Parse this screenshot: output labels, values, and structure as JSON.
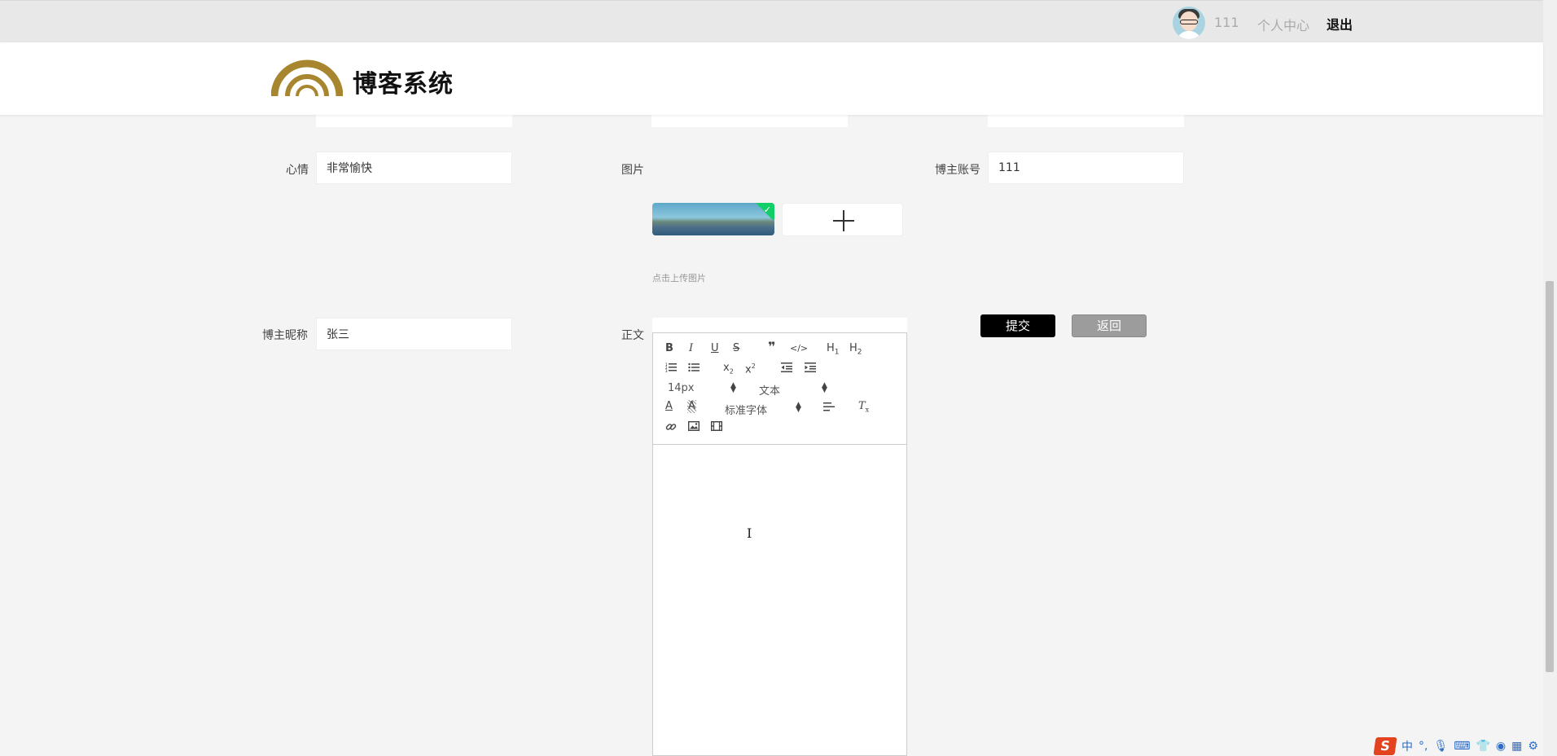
{
  "topbar": {
    "username": "111",
    "personal_center": "个人中心",
    "logout": "退出"
  },
  "header": {
    "site_title": "博客系统"
  },
  "form": {
    "mood_label": "心情",
    "mood_value": "非常愉快",
    "image_label": "图片",
    "upload_tip": "点击上传图片",
    "blogger_account_label": "博主账号",
    "blogger_account_value": "111",
    "blogger_nickname_label": "博主昵称",
    "blogger_nickname_value": "张三",
    "content_label": "正文"
  },
  "editor": {
    "font_size": "14px",
    "paragraph": "文本",
    "font_family": "标准字体"
  },
  "buttons": {
    "submit": "提交",
    "back": "返回"
  },
  "ime": {
    "mode": "中"
  }
}
